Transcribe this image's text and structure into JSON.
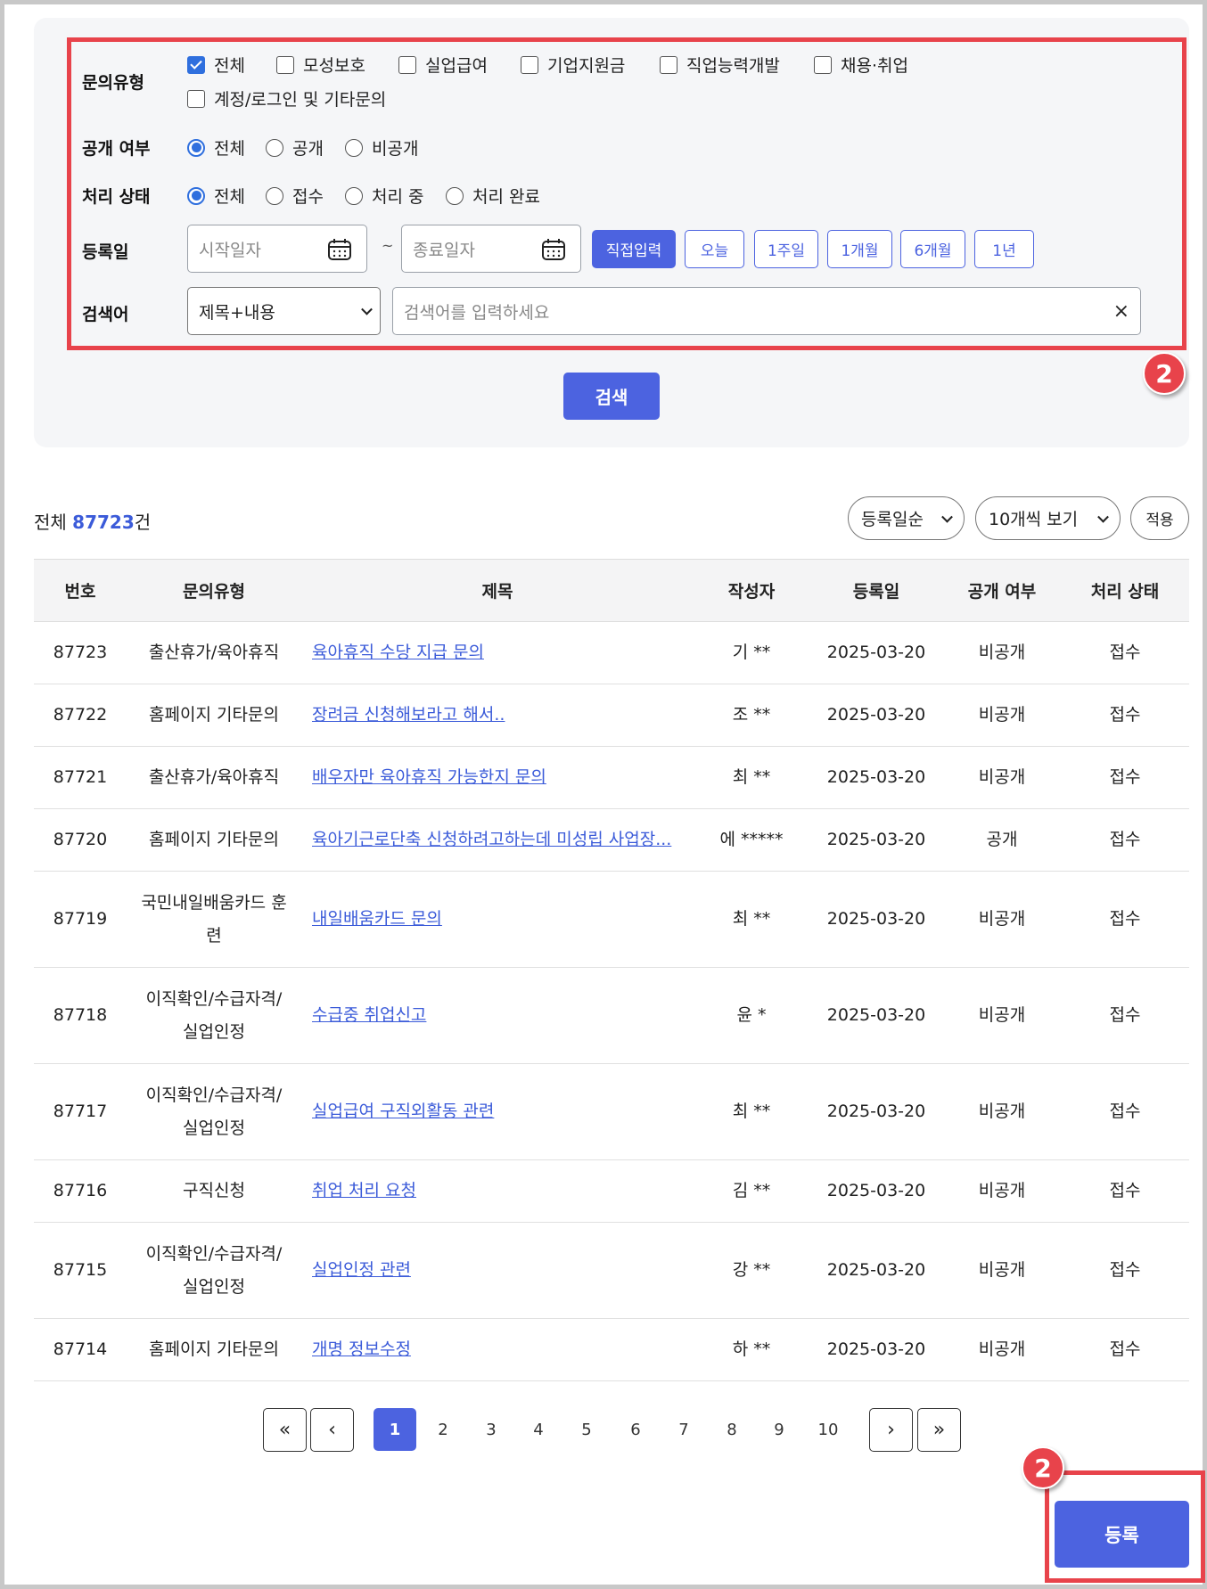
{
  "filters": {
    "inquiry_type": {
      "label": "문의유형",
      "options": [
        {
          "label": "전체",
          "checked": true
        },
        {
          "label": "모성보호",
          "checked": false
        },
        {
          "label": "실업급여",
          "checked": false
        },
        {
          "label": "기업지원금",
          "checked": false
        },
        {
          "label": "직업능력개발",
          "checked": false
        },
        {
          "label": "채용·취업",
          "checked": false
        },
        {
          "label": "계정/로그인 및 기타문의",
          "checked": false
        }
      ]
    },
    "visibility": {
      "label": "공개 여부",
      "options": [
        {
          "label": "전체",
          "selected": true
        },
        {
          "label": "공개",
          "selected": false
        },
        {
          "label": "비공개",
          "selected": false
        }
      ]
    },
    "status": {
      "label": "처리 상태",
      "options": [
        {
          "label": "전체",
          "selected": true
        },
        {
          "label": "접수",
          "selected": false
        },
        {
          "label": "처리 중",
          "selected": false
        },
        {
          "label": "처리 완료",
          "selected": false
        }
      ]
    },
    "reg_date": {
      "label": "등록일",
      "start_placeholder": "시작일자",
      "end_placeholder": "종료일자",
      "separator": "~",
      "periods": [
        "직접입력",
        "오늘",
        "1주일",
        "1개월",
        "6개월",
        "1년"
      ],
      "active_period": "직접입력"
    },
    "keyword": {
      "label": "검색어",
      "field_value": "제목+내용",
      "placeholder": "검색어를 입력하세요",
      "clear": "×"
    },
    "search_button": "검색"
  },
  "annotations": {
    "badge_top": "2",
    "badge_bottom": "2",
    "color": "#e8434b"
  },
  "list": {
    "total_prefix": "전체",
    "total_count": "87723",
    "total_suffix": "건",
    "sort_value": "등록일순",
    "page_size_value": "10개씩 보기",
    "apply_label": "적용",
    "columns": [
      "번호",
      "문의유형",
      "제목",
      "작성자",
      "등록일",
      "공개 여부",
      "처리 상태"
    ],
    "rows": [
      {
        "no": "87723",
        "type": "출산휴가/육아휴직",
        "title": "육아휴직 수당 지급 문의",
        "author": "기 **",
        "date": "2025-03-20",
        "visibility": "비공개",
        "status": "접수"
      },
      {
        "no": "87722",
        "type": "홈페이지 기타문의",
        "title": "장려금 신청해보라고 해서..",
        "author": "조 **",
        "date": "2025-03-20",
        "visibility": "비공개",
        "status": "접수"
      },
      {
        "no": "87721",
        "type": "출산휴가/육아휴직",
        "title": "배우자만 육아휴직 가능한지 문의",
        "author": "최 **",
        "date": "2025-03-20",
        "visibility": "비공개",
        "status": "접수"
      },
      {
        "no": "87720",
        "type": "홈페이지 기타문의",
        "title": "육아기근로단축 신청하려고하는데 미성립 사업장...",
        "author": "에 *****",
        "date": "2025-03-20",
        "visibility": "공개",
        "status": "접수"
      },
      {
        "no": "87719",
        "type": "국민내일배움카드 훈련",
        "title": "내일배움카드 문의",
        "author": "최 **",
        "date": "2025-03-20",
        "visibility": "비공개",
        "status": "접수"
      },
      {
        "no": "87718",
        "type": "이직확인/수급자격/실업인정",
        "title": "수급중 취업신고",
        "author": "윤 *",
        "date": "2025-03-20",
        "visibility": "비공개",
        "status": "접수"
      },
      {
        "no": "87717",
        "type": "이직확인/수급자격/실업인정",
        "title": "실업급여 구직외활동 관련",
        "author": "최 **",
        "date": "2025-03-20",
        "visibility": "비공개",
        "status": "접수"
      },
      {
        "no": "87716",
        "type": "구직신청",
        "title": "취업 처리 요청",
        "author": "김 **",
        "date": "2025-03-20",
        "visibility": "비공개",
        "status": "접수"
      },
      {
        "no": "87715",
        "type": "이직확인/수급자격/실업인정",
        "title": "실업인정 관련",
        "author": "강 **",
        "date": "2025-03-20",
        "visibility": "비공개",
        "status": "접수"
      },
      {
        "no": "87714",
        "type": "홈페이지 기타문의",
        "title": "개명 정보수정",
        "author": "하 **",
        "date": "2025-03-20",
        "visibility": "비공개",
        "status": "접수"
      }
    ]
  },
  "pagination": {
    "first": "«",
    "prev": "‹",
    "next": "›",
    "last": "»",
    "pages": [
      "1",
      "2",
      "3",
      "4",
      "5",
      "6",
      "7",
      "8",
      "9",
      "10"
    ],
    "current": "1"
  },
  "register_button": "등록",
  "colors": {
    "accent": "#4c63e0",
    "link": "#3b5bd9",
    "annotation": "#e8434b"
  }
}
